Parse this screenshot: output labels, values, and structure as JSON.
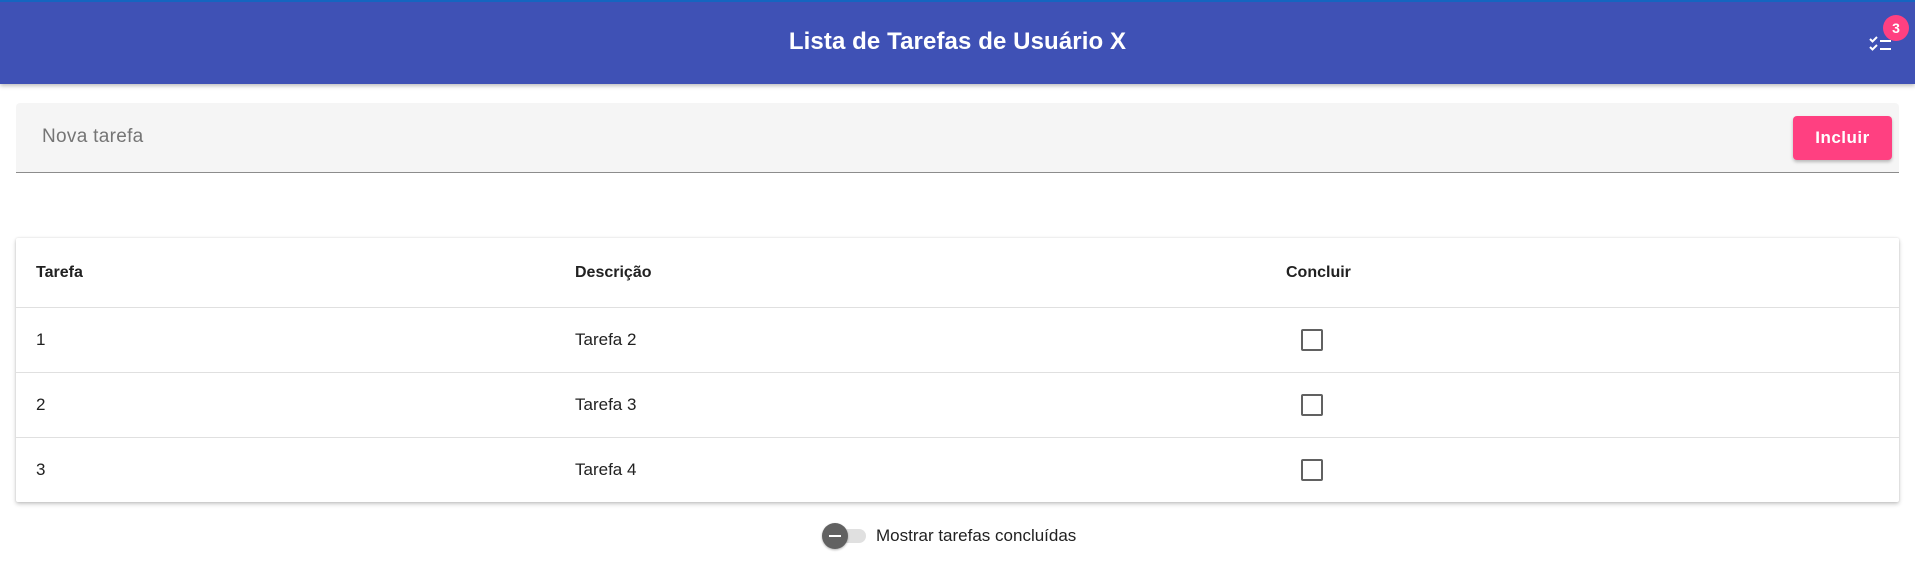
{
  "app_bar": {
    "title": "Lista de Tarefas de Usuário X",
    "tasks_icon": "checklist-icon",
    "badge_count": "3",
    "background": "#3f51b5"
  },
  "new_task": {
    "placeholder": "Nova tarefa",
    "value": "",
    "add_label": "Incluir",
    "accent": "#ff4081"
  },
  "table": {
    "headers": {
      "task": "Tarefa",
      "description": "Descrição",
      "complete": "Concluir"
    },
    "rows": [
      {
        "task": "1",
        "description": "Tarefa 2",
        "complete": false
      },
      {
        "task": "2",
        "description": "Tarefa 3",
        "complete": false
      },
      {
        "task": "3",
        "description": "Tarefa 4",
        "complete": false
      }
    ]
  },
  "toggle": {
    "label": "Mostrar tarefas concluídas",
    "checked": false
  }
}
